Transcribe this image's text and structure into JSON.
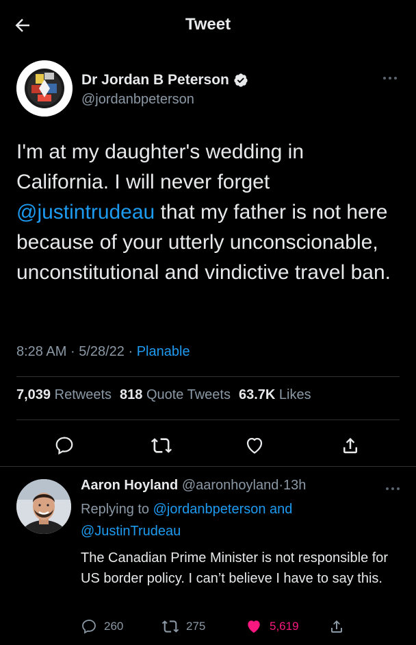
{
  "header": {
    "title": "Tweet"
  },
  "tweet": {
    "author_name": "Dr Jordan B Peterson",
    "author_handle": "@jordanbpeterson",
    "text_part1": "I'm at my daughter's wedding in California. I will never forget ",
    "mention": "@justintrudeau",
    "text_part2": " that my father is not here because of your utterly unconscionable, unconstitutional and vindictive travel ban.",
    "time": "8:28 AM",
    "date": "5/28/22",
    "separator": "·",
    "source": "Planable",
    "retweets_count": "7,039",
    "retweets_label": "Retweets",
    "quotes_count": "818",
    "quotes_label": "Quote Tweets",
    "likes_count": "63.7K",
    "likes_label": "Likes"
  },
  "reply": {
    "author_name": "Aaron Hoyland",
    "author_handle": "@aaronhoyland",
    "time": "13h",
    "replying_prefix": "Replying to",
    "replying_handle1": "@jordanbpeterson",
    "replying_and": "and",
    "replying_handle2": "@JustinTrudeau",
    "text": "The Canadian Prime Minister is not responsible for US border policy. I can’t believe I have to say this.",
    "replies_count": "260",
    "retweets_count": "275",
    "likes_count": "5,619"
  },
  "colors": {
    "background": "#000000",
    "text": "#e7e9ea",
    "secondary": "#8b98a5",
    "accent": "#1d9bf0",
    "like": "#f91880"
  },
  "icons": [
    "back-arrow-icon",
    "verified-icon",
    "more-icon",
    "reply-icon",
    "retweet-icon",
    "like-icon",
    "share-icon"
  ]
}
